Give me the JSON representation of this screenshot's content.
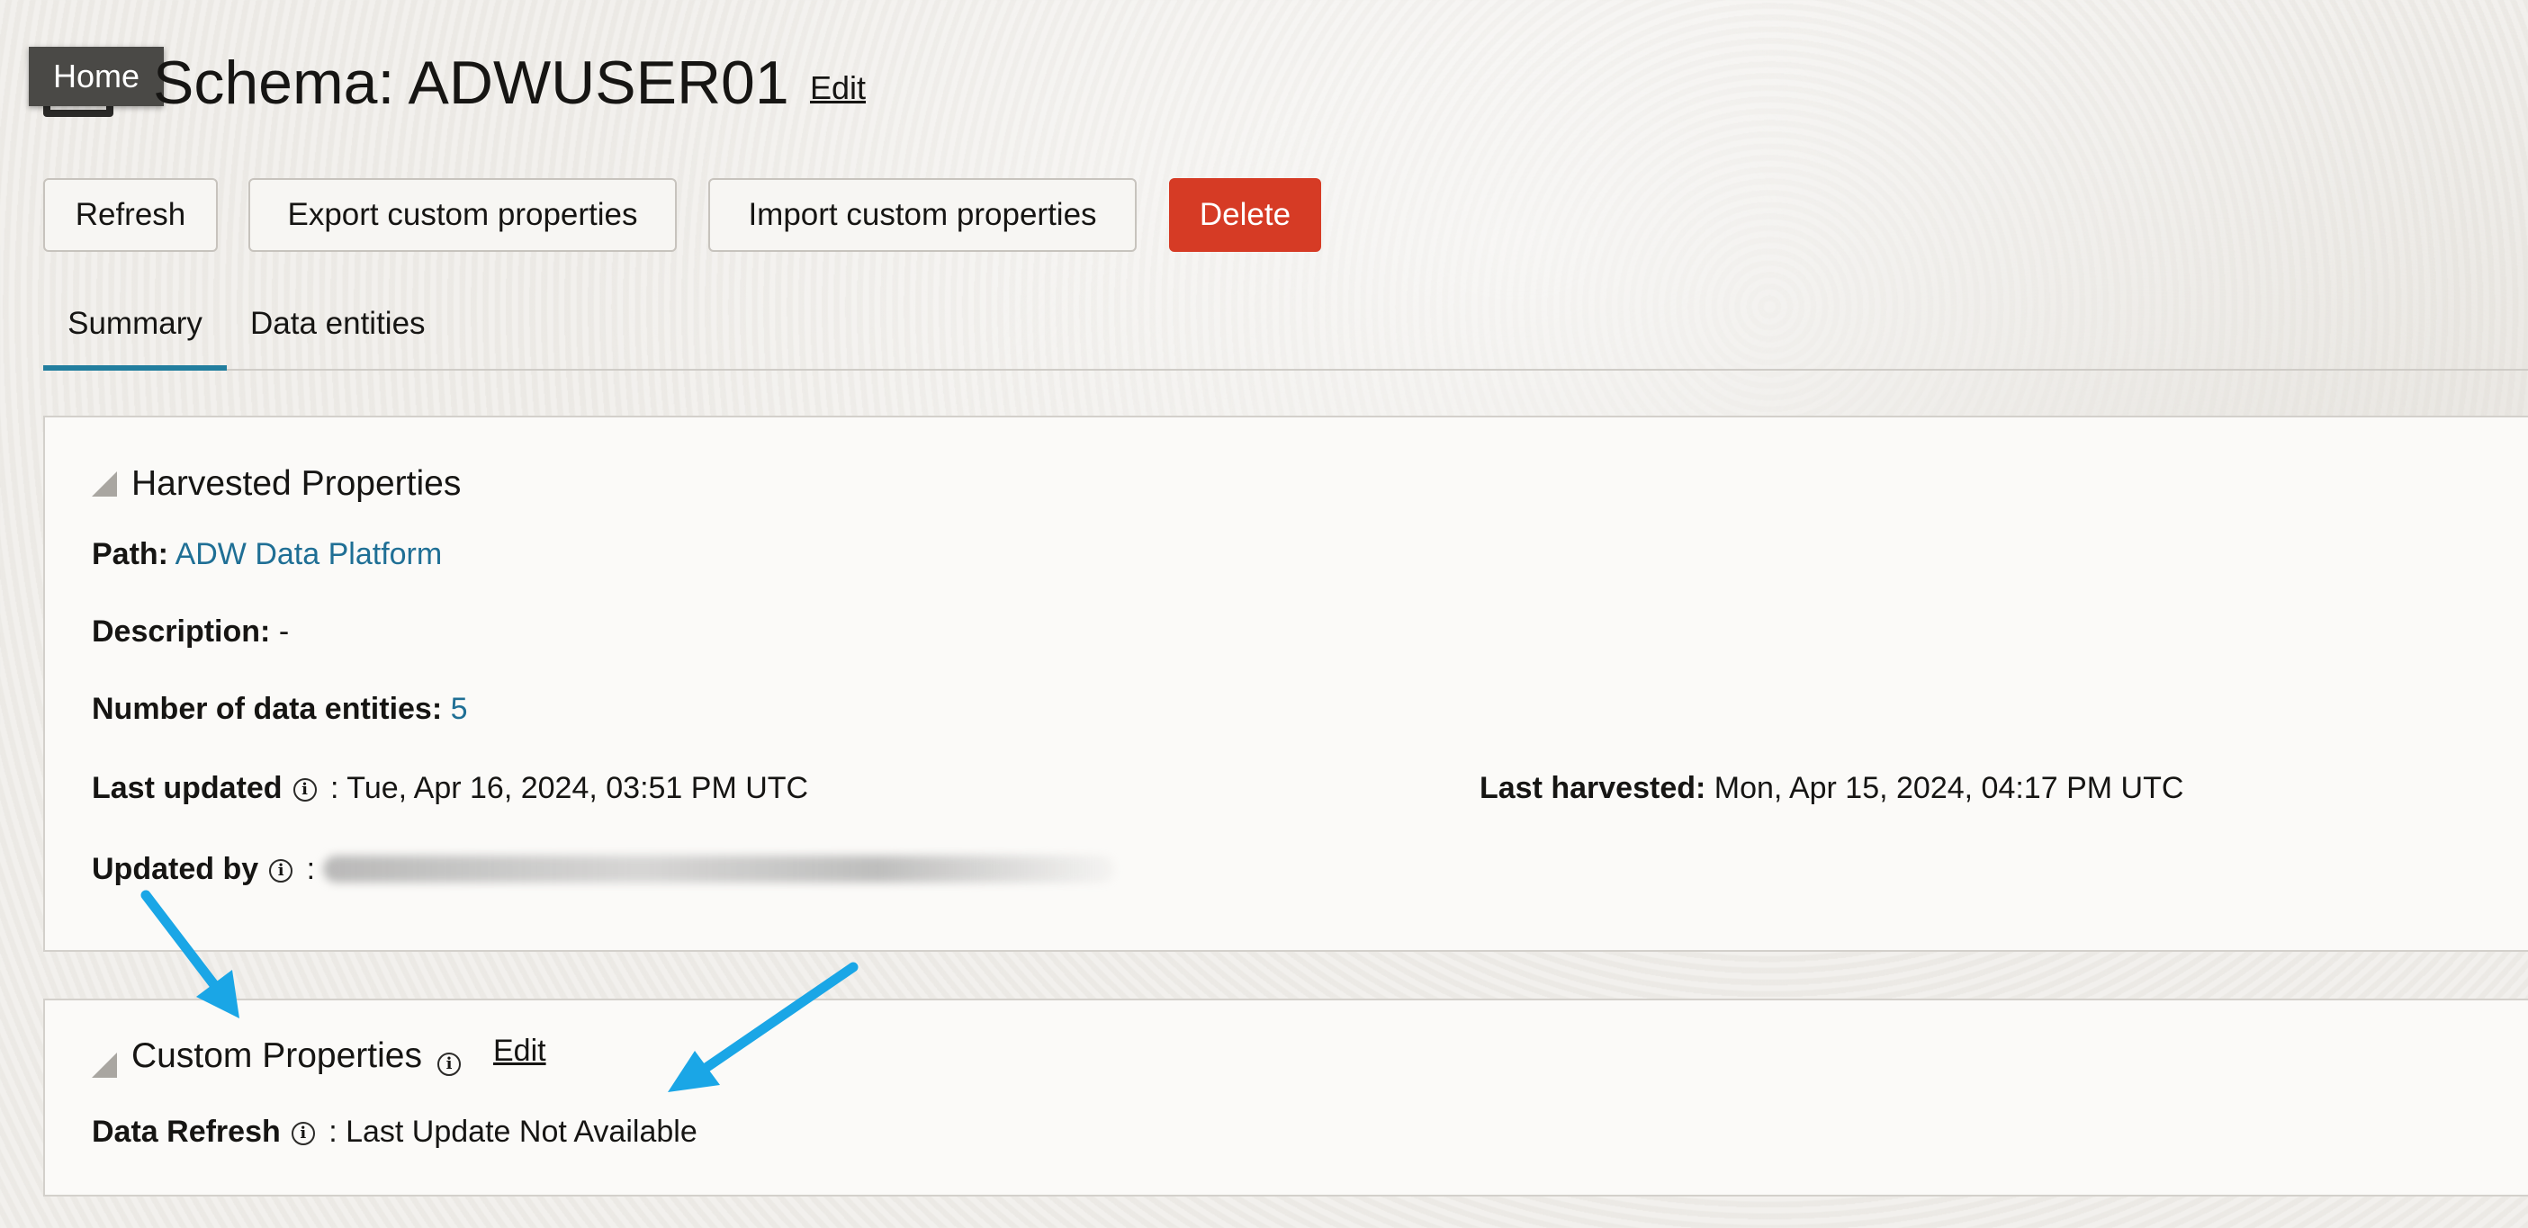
{
  "header": {
    "tooltip": "Home",
    "title": "Schema: ADWUSER01",
    "edit_label": "Edit"
  },
  "toolbar": {
    "refresh_label": "Refresh",
    "export_label": "Export custom properties",
    "import_label": "Import custom properties",
    "delete_label": "Delete"
  },
  "tabs": [
    {
      "label": "Summary",
      "active": true
    },
    {
      "label": "Data entities",
      "active": false
    }
  ],
  "harvested": {
    "title": "Harvested Properties",
    "path_label": "Path:",
    "path_value": "ADW Data Platform",
    "description_label": "Description:",
    "description_value": "-",
    "entities_label": "Number of data entities:",
    "entities_value": "5",
    "last_updated_label": "Last updated",
    "last_updated_value": ": Tue, Apr 16, 2024, 03:51 PM UTC",
    "last_harvested_label": "Last harvested:",
    "last_harvested_value": "Mon, Apr 15, 2024, 04:17 PM UTC",
    "updated_by_label": "Updated by",
    "updated_by_separator": ":"
  },
  "custom": {
    "title": "Custom Properties",
    "edit_label": "Edit",
    "data_refresh_label": "Data Refresh",
    "data_refresh_value": ": Last Update Not Available"
  },
  "colors": {
    "delete_button": "#d63b25",
    "link": "#1f6f95",
    "active_tab_underline": "#227e9e",
    "annotation_arrow": "#1aa6e6"
  }
}
